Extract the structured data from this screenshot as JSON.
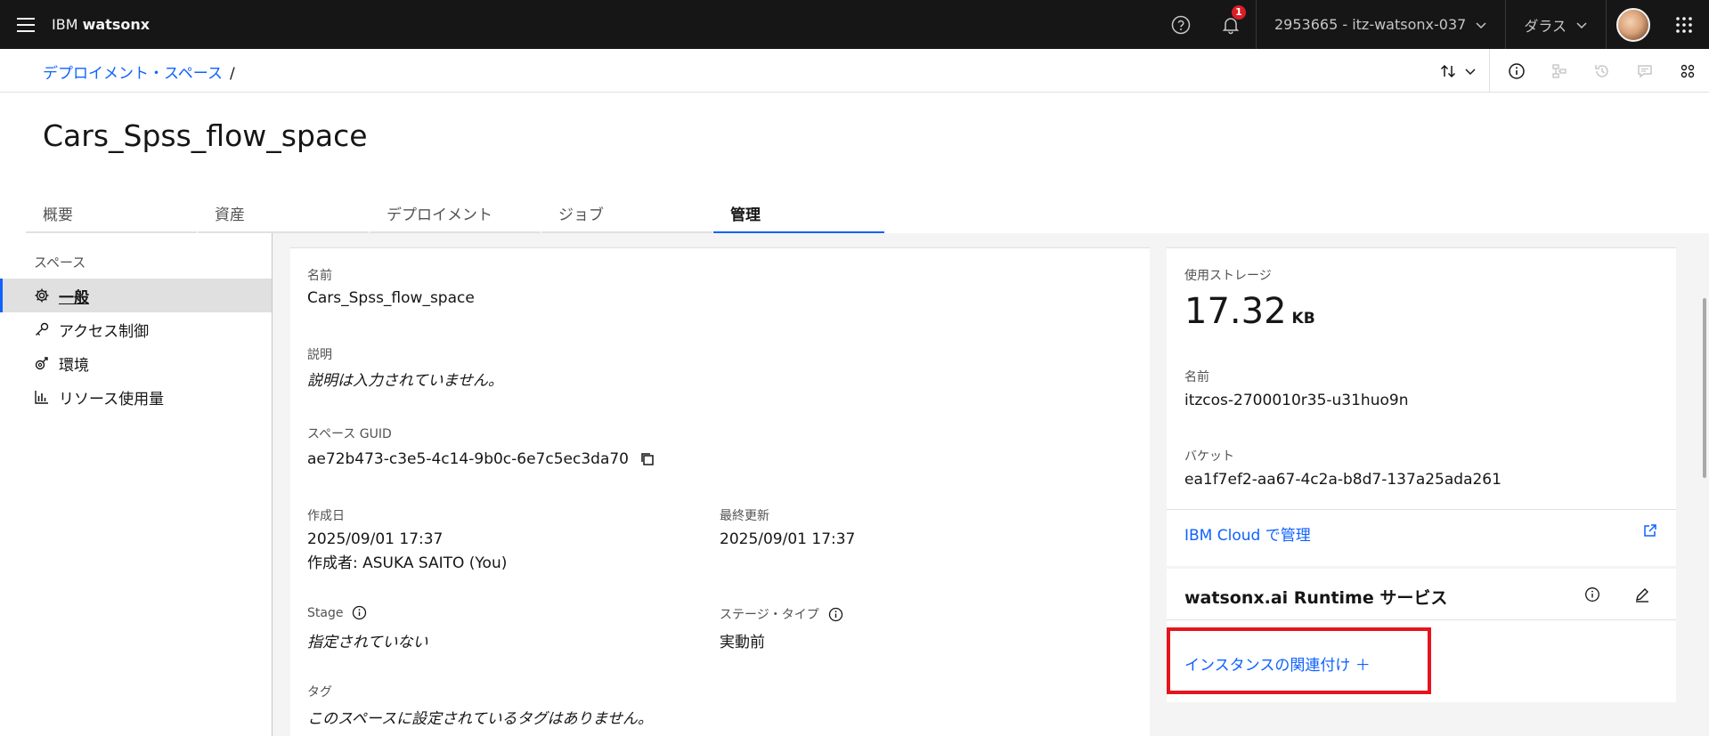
{
  "header": {
    "brand_prefix": "IBM",
    "brand_name": "watsonx",
    "notification_count": "1",
    "account": "2953665 - itz-watsonx-037",
    "region": "ダラス"
  },
  "breadcrumb": {
    "root": "デプロイメント・スペース",
    "separator": "/"
  },
  "page": {
    "title": "Cars_Spss_flow_space"
  },
  "tabs": [
    {
      "label": "概要",
      "active": false
    },
    {
      "label": "資産",
      "active": false
    },
    {
      "label": "デプロイメント",
      "active": false
    },
    {
      "label": "ジョブ",
      "active": false
    },
    {
      "label": "管理",
      "active": true
    }
  ],
  "sidebar": {
    "heading": "スペース",
    "items": [
      {
        "label": "一般",
        "icon": "gear-icon",
        "active": true
      },
      {
        "label": "アクセス制御",
        "icon": "key-icon",
        "active": false
      },
      {
        "label": "環境",
        "icon": "environment-icon",
        "active": false
      },
      {
        "label": "リソース使用量",
        "icon": "bar-chart-icon",
        "active": false
      }
    ]
  },
  "details": {
    "name_label": "名前",
    "name_value": "Cars_Spss_flow_space",
    "desc_label": "説明",
    "desc_value": "説明は入力されていません。",
    "guid_label": "スペース GUID",
    "guid_value": "ae72b473-c3e5-4c14-9b0c-6e7c5ec3da70",
    "created_label": "作成日",
    "created_value": "2025/09/01 17:37",
    "creator_value": "作成者: ASUKA SAITO (You)",
    "updated_label": "最終更新",
    "updated_value": "2025/09/01 17:37",
    "stage_label": "Stage",
    "stage_value": "指定されていない",
    "stage_type_label": "ステージ・タイプ",
    "stage_type_value": "実動前",
    "tags_label": "タグ",
    "tags_value": "このスペースに設定されているタグはありません。"
  },
  "storage": {
    "used_label": "使用ストレージ",
    "used_value": "17.32",
    "used_unit": "KB",
    "name_label": "名前",
    "name_value": "itzcos-2700010r35-u31huo9n",
    "bucket_label": "バケット",
    "bucket_value": "ea1f7ef2-aa67-4c2a-b8d7-137a25ada261",
    "manage_link": "IBM Cloud で管理"
  },
  "runtime": {
    "title": "watsonx.ai Runtime サービス",
    "associate_link": "インスタンスの関連付け ＋"
  },
  "colors": {
    "accent": "#0f62fe",
    "topbar": "#161616",
    "highlight_box": "#e5141d",
    "badge": "#da1e28"
  }
}
